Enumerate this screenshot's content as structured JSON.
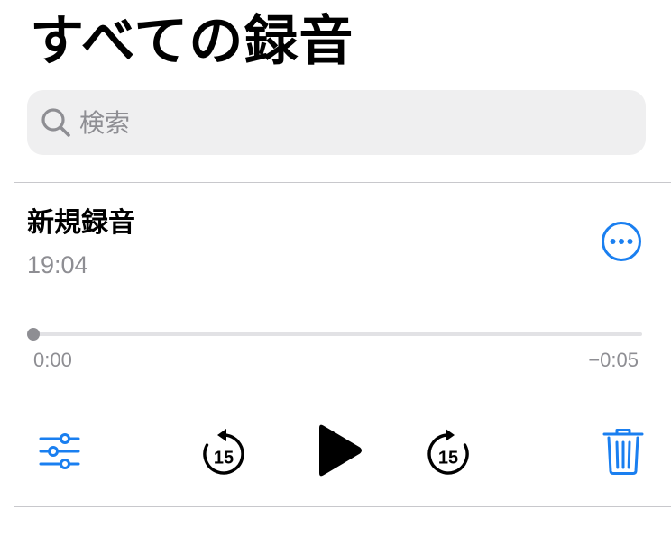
{
  "header": {
    "title": "すべての録音"
  },
  "search": {
    "placeholder": "検索",
    "value": ""
  },
  "recording": {
    "title": "新規録音",
    "time": "19:04"
  },
  "playback": {
    "elapsed": "0:00",
    "remaining": "−0:05",
    "progress_fraction": 0,
    "skip_back_seconds": "15",
    "skip_forward_seconds": "15"
  },
  "icons": {
    "search": "search-icon",
    "more": "ellipsis-circle-icon",
    "options": "sliders-icon",
    "skip_back": "skip-back-15-icon",
    "play": "play-icon",
    "skip_forward": "skip-forward-15-icon",
    "delete": "trash-icon"
  },
  "colors": {
    "accent": "#1a7ff0",
    "secondary_text": "#8e8e93",
    "search_background": "#efeff0",
    "divider": "#c8c8cc"
  }
}
